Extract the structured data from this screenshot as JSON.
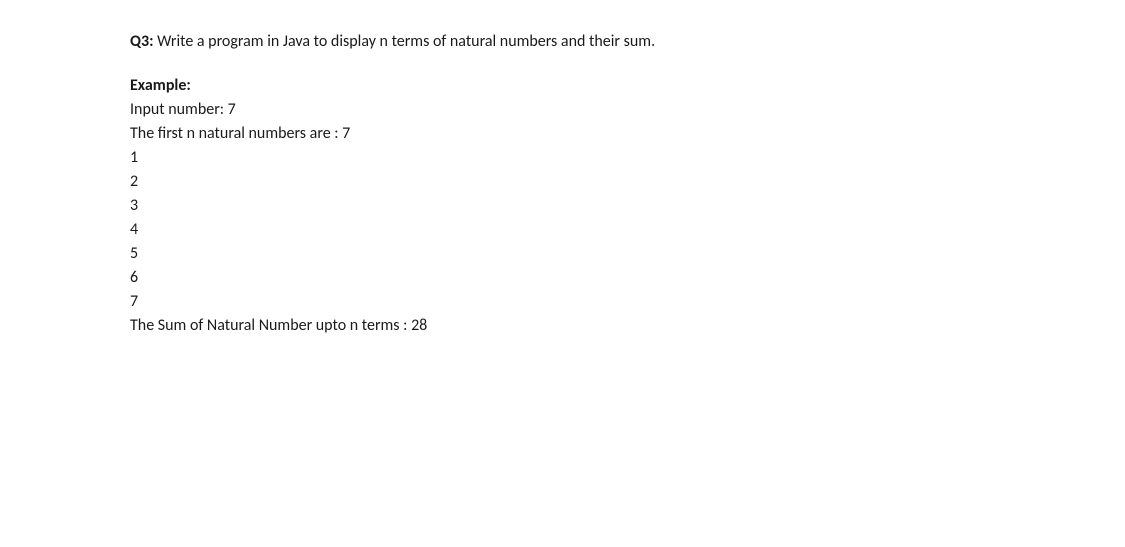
{
  "question": {
    "label": "Q3:",
    "text": " Write a program in Java to display n terms of natural numbers and their sum."
  },
  "example": {
    "label": "Example:",
    "input": "Input number: 7",
    "header": "The first n natural numbers are : 7",
    "numbers": [
      "1",
      "2",
      "3",
      "4",
      "5",
      "6",
      "7"
    ],
    "sum": "The Sum of Natural Number upto n terms : 28"
  }
}
